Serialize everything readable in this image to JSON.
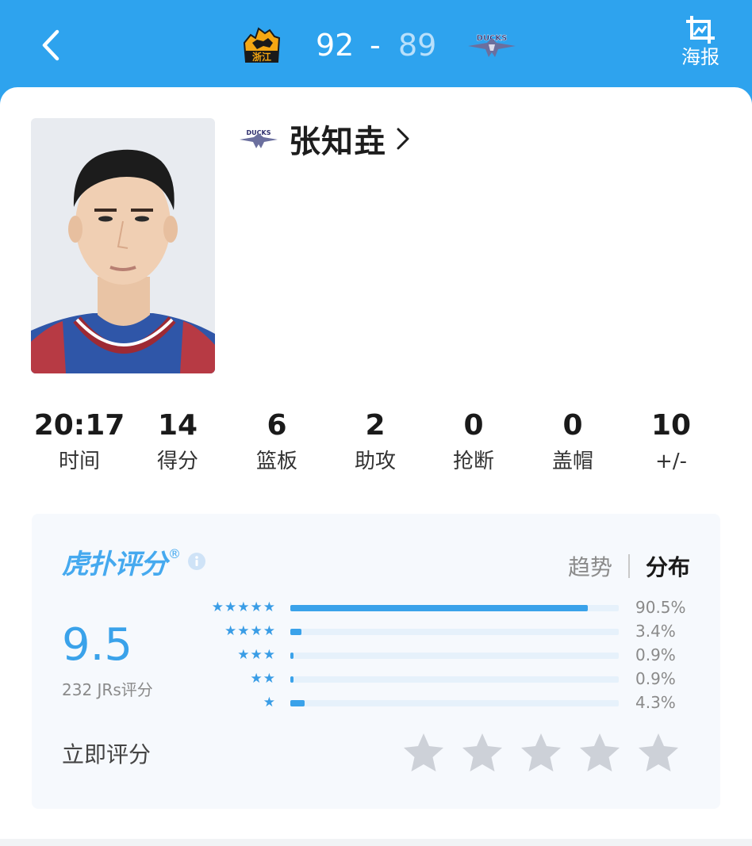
{
  "header": {
    "back_icon": "chevron-left-icon",
    "home_team": {
      "logo": "zhejiang-lions-logo",
      "logo_text": "浙江",
      "score": "92"
    },
    "score_separator": "-",
    "away_team": {
      "logo": "beijing-ducks-logo",
      "logo_text": "DUCKS",
      "score": "89"
    },
    "poster": {
      "icon": "image-crop-icon",
      "label": "海报"
    }
  },
  "player": {
    "name": "张知垚",
    "team_badge": "beijing-ducks-logo",
    "photo": "player-headshot"
  },
  "stats": [
    {
      "value": "20:17",
      "label": "时间"
    },
    {
      "value": "14",
      "label": "得分"
    },
    {
      "value": "6",
      "label": "篮板"
    },
    {
      "value": "2",
      "label": "助攻"
    },
    {
      "value": "0",
      "label": "抢断"
    },
    {
      "value": "0",
      "label": "盖帽"
    },
    {
      "value": "10",
      "label": "+/-"
    }
  ],
  "rating": {
    "brand": "虎扑评分",
    "brand_mark": "®",
    "tabs": [
      {
        "label": "趋势",
        "active": false
      },
      {
        "label": "分布",
        "active": true
      }
    ],
    "score": "9.5",
    "votes": "232 JRs评分",
    "distribution": [
      {
        "stars": 5,
        "stars_text": "★★★★★",
        "percent": 90.5,
        "label": "90.5%"
      },
      {
        "stars": 4,
        "stars_text": "★★★★",
        "percent": 3.4,
        "label": "3.4%"
      },
      {
        "stars": 3,
        "stars_text": "★★★",
        "percent": 0.9,
        "label": "0.9%"
      },
      {
        "stars": 2,
        "stars_text": "★★",
        "percent": 0.9,
        "label": "0.9%"
      },
      {
        "stars": 1,
        "stars_text": "★",
        "percent": 4.3,
        "label": "4.3%"
      }
    ],
    "rate_now_label": "立即评分",
    "rate_star_count": 5
  },
  "colors": {
    "header_bg": "#2ea3ee",
    "accent": "#3aa2ea",
    "away_score": "#b9e0fb",
    "star_empty": "#cdd1d8"
  }
}
